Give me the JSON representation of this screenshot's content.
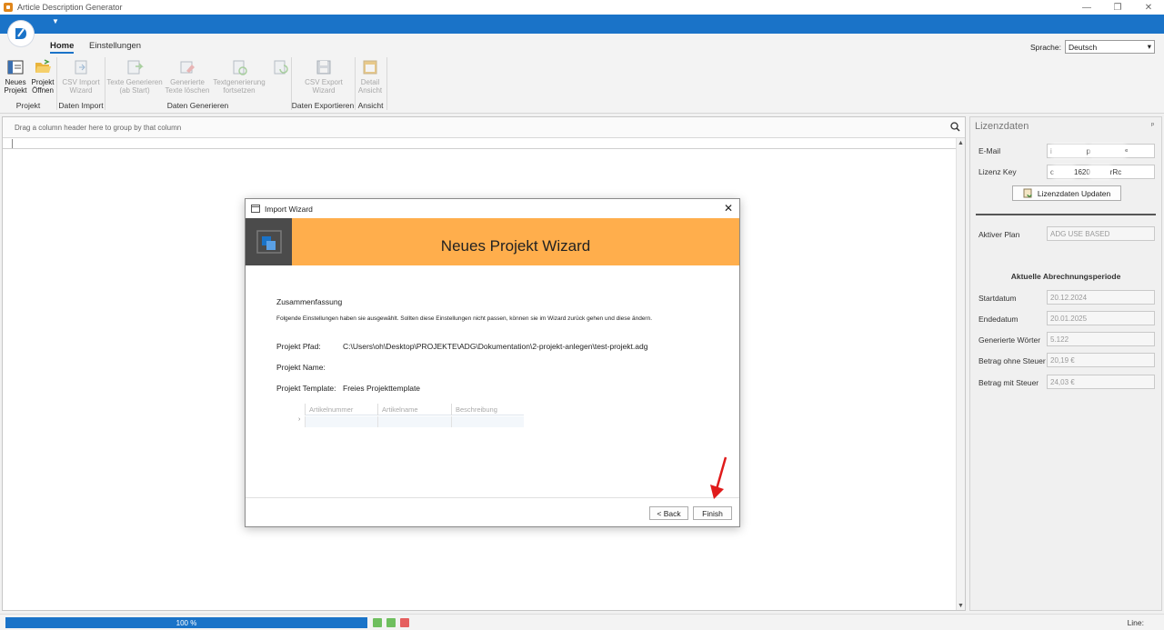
{
  "window": {
    "title": "Article Description Generator",
    "controls": [
      "—",
      "❐",
      "✕"
    ]
  },
  "ribbon": {
    "tabs": [
      {
        "label": "Home",
        "active": true
      },
      {
        "label": "Einstellungen",
        "active": false
      }
    ],
    "language": {
      "label": "Sprache:",
      "value": "Deutsch"
    },
    "buttons": {
      "new_project": {
        "line1": "Neues",
        "line2": "Projekt"
      },
      "open_project": {
        "line1": "Projekt",
        "line2": "Öffnen"
      },
      "csv_import": {
        "line1": "CSV Import",
        "line2": "Wizard"
      },
      "generate_texts": {
        "line1": "Texte Generieren",
        "line2": "(ab Start)"
      },
      "delete_generated": {
        "line1": "Generierte",
        "line2": "Texte löschen"
      },
      "continue_generation": {
        "line1": "Textgenerierung",
        "line2": "fortsetzen"
      },
      "csv_export": {
        "line1": "CSV Export",
        "line2": "Wizard"
      },
      "detail_view": {
        "line1": "Detail",
        "line2": "Ansicht"
      }
    },
    "groups": {
      "projekt": "Projekt",
      "daten_import": "Daten Import",
      "daten_generieren": "Daten Generieren",
      "daten_exportieren": "Daten Exportieren",
      "ansicht": "Ansicht"
    }
  },
  "grid": {
    "group_by_hint": "Drag a column header here to group by that column"
  },
  "license_panel": {
    "title": "Lizenzdaten",
    "pin": "ᵖ",
    "email": {
      "label": "E-Mail",
      "value_start": "i",
      "value_mid": "p",
      "value_end": "ᵉ"
    },
    "license_key": {
      "label": "Lizenz Key",
      "value_start": "c",
      "value_mid": "1620",
      "value_end": "rRc"
    },
    "update_button": "Lizenzdaten Updaten",
    "plan": {
      "label": "Aktiver Plan",
      "value": "ADG USE BASED"
    },
    "period_title": "Aktuelle Abrechnungsperiode",
    "fields": [
      {
        "label": "Startdatum",
        "value": "20.12.2024"
      },
      {
        "label": "Endedatum",
        "value": "20.01.2025"
      },
      {
        "label": "Generierte Wörter",
        "value": "5.122"
      },
      {
        "label": "Betrag ohne Steuer",
        "value": "20,19 €"
      },
      {
        "label": "Betrag mit Steuer",
        "value": "24,03 €"
      }
    ]
  },
  "status": {
    "progress_text": "100 %",
    "progress": 1.0,
    "line_label": "Line:"
  },
  "dialog": {
    "title": "Import Wizard",
    "header_title": "Neues Projekt Wizard",
    "summary_heading": "Zusammenfassung",
    "summary_text": "Folgende Einstellungen haben sie ausgewählt. Sollten diese Einstellungen nicht passen, können sie im Wizard zurück gehen und diese ändern.",
    "path_label": "Projekt Pfad:",
    "path_value": "C:\\Users\\oh\\Desktop\\PROJEKTE\\ADG\\Dokumentation\\2-projekt-anlegen\\test-projekt.adg",
    "name_label": "Projekt Name:",
    "template_label": "Projekt Template:",
    "template_value": "Freies Projekttemplate",
    "columns": [
      "Artikelnummer",
      "Artikelname",
      "Beschreibung"
    ],
    "back_button": "< Back",
    "finish_button": "Finish"
  },
  "colors": {
    "accent": "#1a73c8",
    "wizard_header": "#ffae4c",
    "arrow": "#e01b1b"
  }
}
